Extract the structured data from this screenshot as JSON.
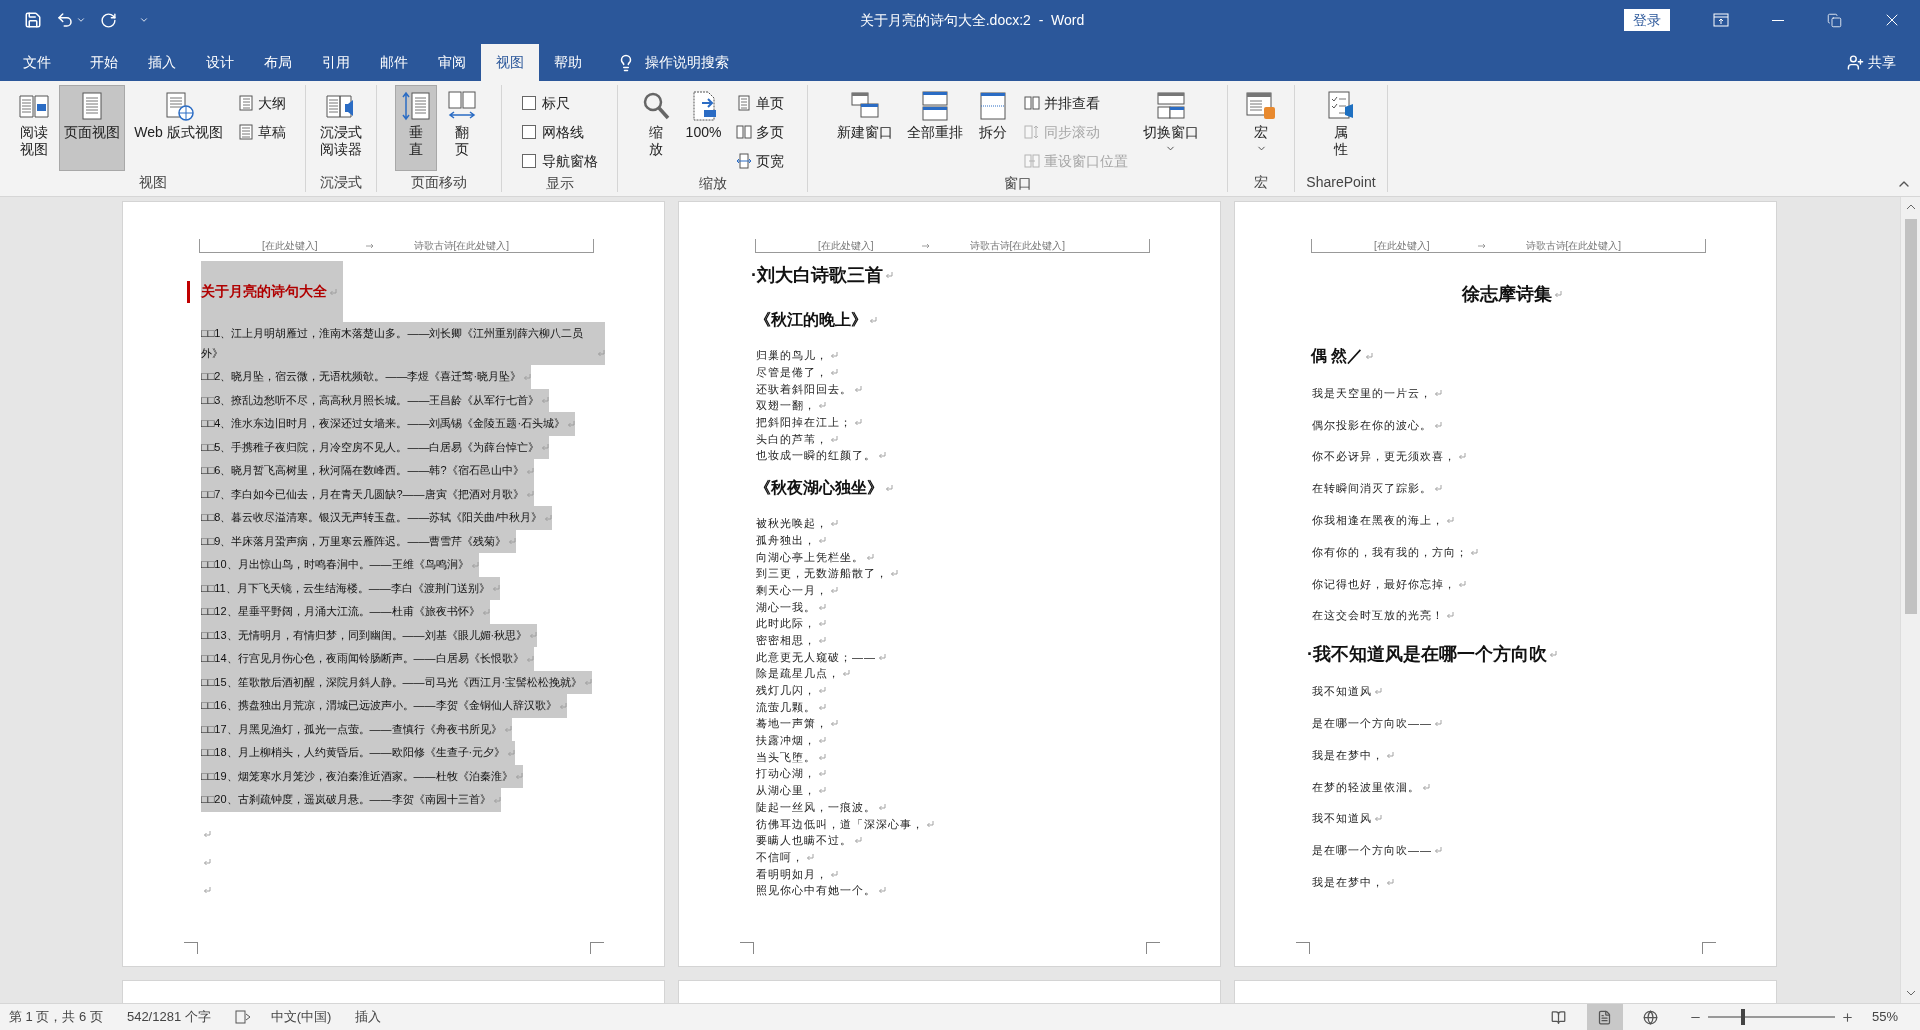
{
  "window": {
    "title": "关于月亮的诗句大全.docx:2  -  Word",
    "sign_in": "登录"
  },
  "menu_tabs": [
    {
      "label": "文件",
      "selected": false
    },
    {
      "label": "开始",
      "selected": false
    },
    {
      "label": "插入",
      "selected": false
    },
    {
      "label": "设计",
      "selected": false
    },
    {
      "label": "布局",
      "selected": false
    },
    {
      "label": "引用",
      "selected": false
    },
    {
      "label": "邮件",
      "selected": false
    },
    {
      "label": "审阅",
      "selected": false
    },
    {
      "label": "视图",
      "selected": true
    },
    {
      "label": "帮助",
      "selected": false
    }
  ],
  "tell_me": "操作说明搜索",
  "share": "共享",
  "ribbon_groups": [
    {
      "label": "视图",
      "items": [
        {
          "kind": "large",
          "label": "阅读视图",
          "selected": false
        },
        {
          "kind": "large",
          "label": "页面视图",
          "selected": true
        },
        {
          "kind": "large",
          "label": "Web 版式视图",
          "selected": false
        },
        {
          "kind": "stack",
          "entries": [
            {
              "kind": "small",
              "label": "大纲",
              "disabled": false
            },
            {
              "kind": "small",
              "label": "草稿",
              "disabled": false
            }
          ]
        }
      ]
    },
    {
      "label": "沉浸式",
      "items": [
        {
          "kind": "large",
          "label": "沉浸式阅读器"
        }
      ]
    },
    {
      "label": "页面移动",
      "items": [
        {
          "kind": "large",
          "label": "垂直",
          "selected": true
        },
        {
          "kind": "large",
          "label": "翻页",
          "selected": false
        }
      ]
    },
    {
      "label": "显示",
      "items": [
        {
          "kind": "stack",
          "entries": [
            {
              "kind": "checkbox",
              "label": "标尺",
              "checked": false
            },
            {
              "kind": "checkbox",
              "label": "网格线",
              "checked": false
            },
            {
              "kind": "checkbox",
              "label": "导航窗格",
              "checked": false
            }
          ]
        }
      ]
    },
    {
      "label": "缩放",
      "items": [
        {
          "kind": "large",
          "label": "缩放"
        },
        {
          "kind": "large",
          "label": "100%"
        },
        {
          "kind": "stack",
          "entries": [
            {
              "kind": "small",
              "label": "单页",
              "disabled": false
            },
            {
              "kind": "small",
              "label": "多页",
              "disabled": false
            },
            {
              "kind": "small",
              "label": "页宽",
              "disabled": false
            }
          ]
        }
      ]
    },
    {
      "label": "窗口",
      "items": [
        {
          "kind": "large",
          "label": "新建窗口"
        },
        {
          "kind": "large",
          "label": "全部重排"
        },
        {
          "kind": "large",
          "label": "拆分"
        },
        {
          "kind": "stack",
          "entries": [
            {
              "kind": "small",
              "label": "并排查看",
              "disabled": false
            },
            {
              "kind": "small",
              "label": "同步滚动",
              "disabled": true
            },
            {
              "kind": "small",
              "label": "重设窗口位置",
              "disabled": true
            }
          ]
        },
        {
          "kind": "large",
          "label": "切换窗口",
          "menu": true
        }
      ]
    },
    {
      "label": "宏",
      "items": [
        {
          "kind": "large",
          "label": "宏",
          "menu": true
        }
      ]
    },
    {
      "label": "SharePoint",
      "items": [
        {
          "kind": "large",
          "label": "属性"
        }
      ]
    }
  ],
  "pages": [
    {
      "kind": "list",
      "header_left": "[在此处键入]",
      "header_right": "诗歌古诗[在此处键入]",
      "title": "关于月亮的诗句大全",
      "highlighted": true,
      "lines": [
        "□□1、江上月明胡雁过，淮南木落楚山多。——刘长卿《江州重别薛六柳八二员外》",
        "□□2、晓月坠，宿云微，无语枕频欹。——李煜《喜迁莺·晓月坠》",
        "□□3、撩乱边愁听不尽，高高秋月照长城。——王昌龄《从军行七首》",
        "□□4、淮水东边旧时月，夜深还过女墙来。——刘禹锡《金陵五题·石头城》",
        "□□5、手携稚子夜归院，月冷空房不见人。——白居易《为薛台悼亡》",
        "□□6、晓月暂飞高树里，秋河隔在数峰西。——韩?《宿石邑山中》",
        "□□7、李白如今已仙去，月在青天几圆缺?——唐寅《把酒对月歌》",
        "□□8、暮云收尽溢清寒。银汉无声转玉盘。——苏轼《阳关曲/中秋月》",
        "□□9、半床落月蛩声病，万里寒云雁阵迟。——曹雪芹《残菊》",
        "□□10、月出惊山鸟，时鸣春涧中。——王维《鸟鸣涧》",
        "□□11、月下飞天镜，云生结海楼。——李白《渡荆门送别》",
        "□□12、星垂平野阔，月涌大江流。——杜甫《旅夜书怀》",
        "□□13、无情明月，有情归梦，同到幽闺。——刘基《眼儿媚·秋思》",
        "□□14、行宫见月伤心色，夜雨闻铃肠断声。——白居易《长恨歌》",
        "□□15、笙歌散后酒初醒，深院月斜人静。——司马光《西江月·宝髻松松挽就》",
        "□□16、携盘独出月荒凉，渭城已远波声小。——李贺《金铜仙人辞汉歌》",
        "□□17、月黑见渔灯，孤光一点萤。——查慎行《舟夜书所见》",
        "□□18、月上柳梢头，人约黄昏后。——欧阳修《生查子·元夕》",
        "□□19、烟笼寒水月笼沙，夜泊秦淮近酒家。——杜牧《泊秦淮》",
        "□□20、古刹疏钟度，遥岚破月悬。——李贺《南园十三首》"
      ]
    },
    {
      "kind": "compact",
      "header_left": "[在此处键入]",
      "header_right": "诗歌古诗[在此处键入]",
      "heading": "·刘大白诗歌三首",
      "sections": [
        {
          "title": "《秋江的晚上》",
          "lines": [
            "归巢的鸟儿，",
            "尽管是倦了，",
            "还驮着斜阳回去。",
            "双翅一翻，",
            "把斜阳掉在江上；",
            "头白的芦苇，",
            "也妆成一瞬的红颜了。"
          ]
        },
        {
          "title": "《秋夜湖心独坐》",
          "lines": [
            "被秋光唤起，",
            "孤舟独出，",
            "向湖心亭上凭栏坐。",
            "到三更，无数游船散了，",
            "剩天心一月，",
            "湖心一我。",
            "此时此际，",
            "密密相思，",
            "此意更无人窥破；——",
            "除是疏星几点，",
            "残灯几闪，",
            "流萤几颗。",
            "蓦地一声箫，",
            "扶露冲烟，",
            "当头飞堕。",
            "打动心湖，",
            "从湖心里，",
            "陡起一丝风，一痕波。",
            "彷佛耳边低叫，道「深深心事，",
            "要瞒人也瞒不过。",
            "不信呵，",
            "看明明如月，",
            "照见你心中有她一个。"
          ]
        }
      ]
    },
    {
      "kind": "spaced",
      "header_left": "[在此处键入]",
      "header_right": "诗歌古诗[在此处键入]",
      "title": "徐志摩诗集",
      "sections": [
        {
          "kind": "subheading",
          "title": "偶 然／",
          "lines": [
            "我是天空里的一片云，",
            "偶尔投影在你的波心。",
            "你不必讶异，更无须欢喜，",
            "在转瞬间消灭了踪影。",
            "你我相逢在黑夜的海上，",
            "你有你的，我有我的，方向；",
            "你记得也好，最好你忘掉，",
            "在这交会时互放的光亮！"
          ]
        },
        {
          "kind": "heading",
          "title": "·我不知道风是在哪一个方向吹",
          "lines": [
            "我不知道风",
            "是在哪一个方向吹——",
            "我是在梦中，",
            "在梦的轻波里依洄。",
            "我不知道风",
            "是在哪一个方向吹——",
            "我是在梦中，"
          ]
        }
      ]
    }
  ],
  "status_bar": {
    "page": "第 1 页，共 6 页",
    "words": "542/1281 个字",
    "language": "中文(中国)",
    "mode": "插入",
    "view_buttons": [
      {
        "selected": false
      },
      {
        "selected": true
      },
      {
        "selected": false
      }
    ],
    "zoom_slider": {
      "level": 0.26
    },
    "zoom": "55%"
  }
}
